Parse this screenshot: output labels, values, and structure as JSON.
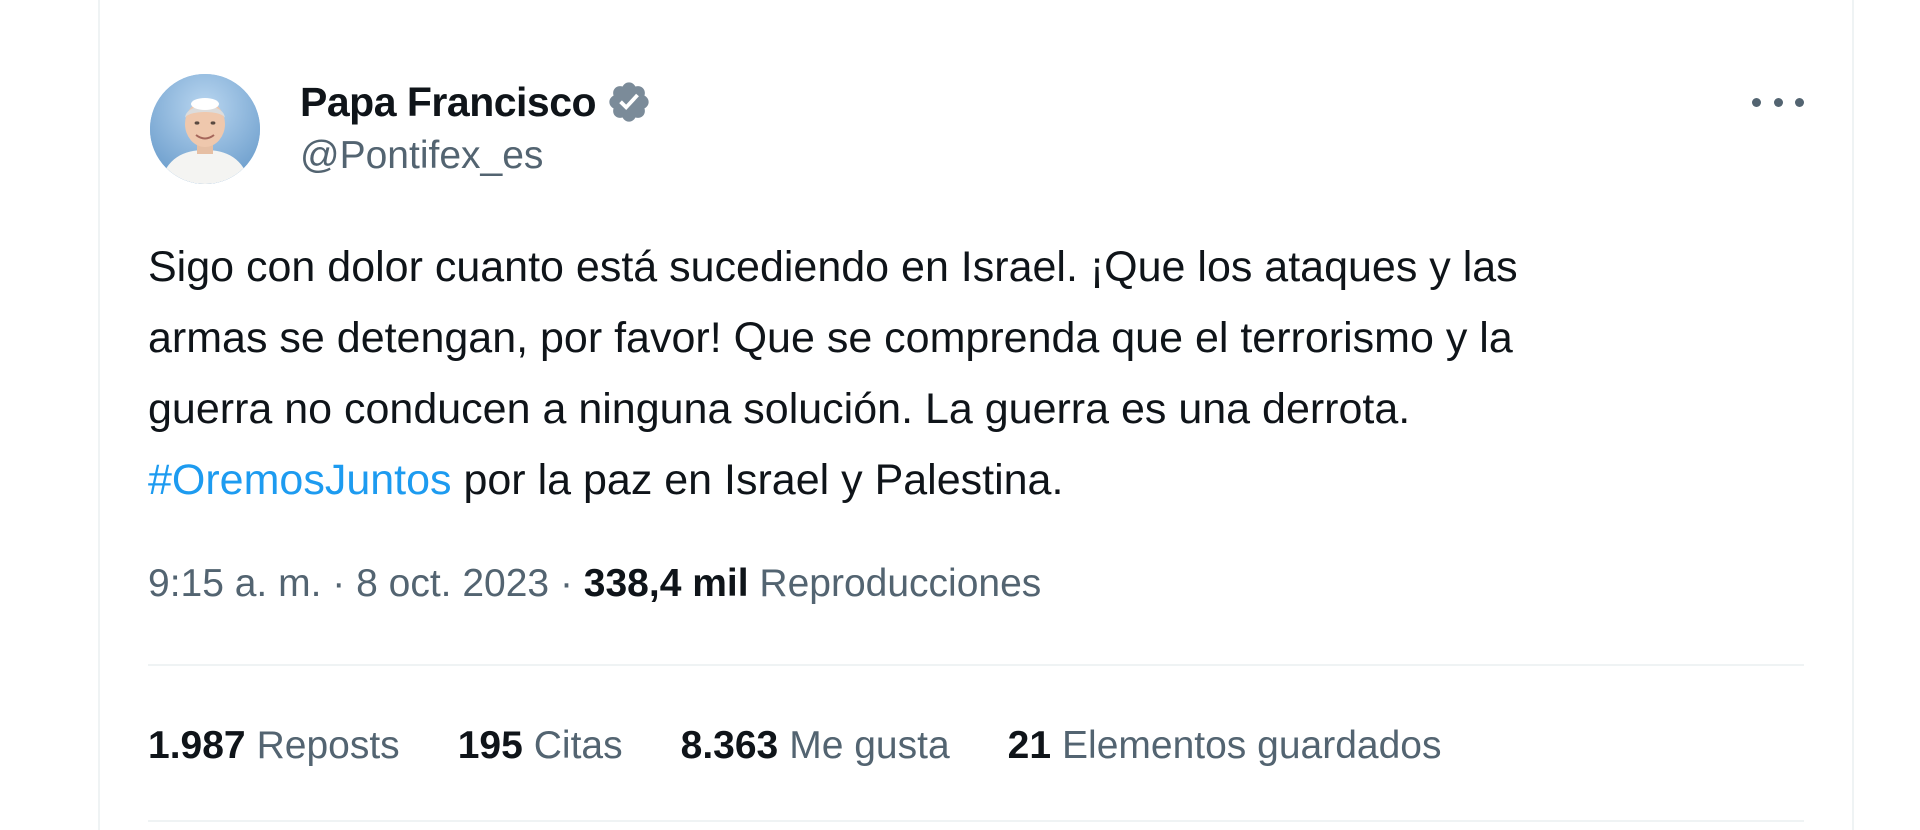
{
  "author": {
    "name": "Papa Francisco",
    "handle": "@Pontifex_es",
    "verified_icon": "verified-badge-icon",
    "badge_color": "#7b8b99"
  },
  "tweet": {
    "text_line1": "Sigo con dolor cuanto está sucediendo en Israel. ¡Que los ataques y las",
    "text_line2": "armas se detengan, por favor! Que se comprenda que el terrorismo y la",
    "text_line3": "guerra no conducen a ninguna solución. La guerra es una derrota.",
    "hashtag": "#OremosJuntos",
    "text_line4_rest": " por la paz en Israel y Palestina."
  },
  "meta": {
    "time": "9:15 a. m.",
    "separator": "·",
    "date": "8 oct. 2023",
    "views_count": "338,4 mil",
    "views_label": "Reproducciones"
  },
  "stats": [
    {
      "count": "1.987",
      "label": "Reposts"
    },
    {
      "count": "195",
      "label": "Citas"
    },
    {
      "count": "8.363",
      "label": "Me gusta"
    },
    {
      "count": "21",
      "label": "Elementos guardados"
    }
  ],
  "colors": {
    "text_primary": "#0f1419",
    "text_secondary": "#536471",
    "link": "#1d9bf0",
    "divider": "#eff3f4"
  },
  "icons": {
    "more": "more-options-icon",
    "avatar": "avatar-portrait"
  }
}
